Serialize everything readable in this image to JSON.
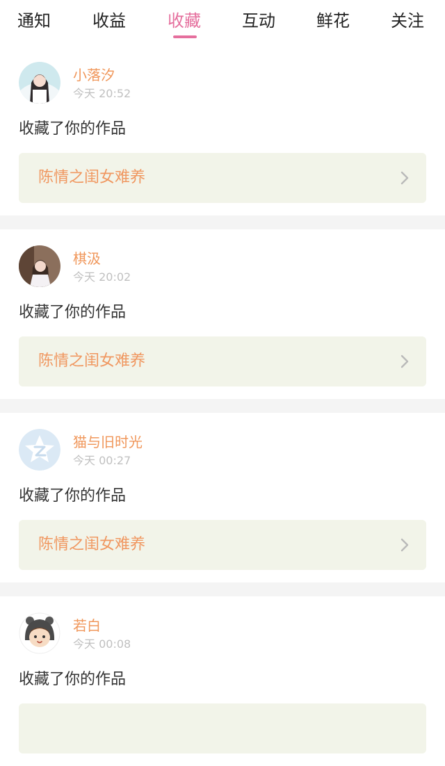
{
  "tabs": [
    {
      "label": "通知"
    },
    {
      "label": "收益"
    },
    {
      "label": "收藏"
    },
    {
      "label": "互动"
    },
    {
      "label": "鲜花"
    },
    {
      "label": "关注"
    }
  ],
  "active_tab": "收藏",
  "notifications": [
    {
      "username": "小落汐",
      "time": "今天 20:52",
      "action": "收藏了你的作品",
      "work_title": "陈情之闺女难养",
      "avatar": "girl-photo-avatar"
    },
    {
      "username": "棋汲",
      "time": "今天 20:02",
      "action": "收藏了你的作品",
      "work_title": "陈情之闺女难养",
      "avatar": "girl-photo-avatar"
    },
    {
      "username": "猫与旧时光",
      "time": "今天 00:27",
      "action": "收藏了你的作品",
      "work_title": "陈情之闺女难养",
      "avatar": "default-star-avatar"
    },
    {
      "username": "若白",
      "time": "今天 00:08",
      "action": "收藏了你的作品",
      "work_title": "",
      "avatar": "cartoon-boy-avatar"
    }
  ],
  "colors": {
    "accent_pink": "#e56f9d",
    "username_orange": "#f0975b",
    "work_card_bg": "#f2f4e9",
    "time_gray": "#c0c0c0"
  }
}
